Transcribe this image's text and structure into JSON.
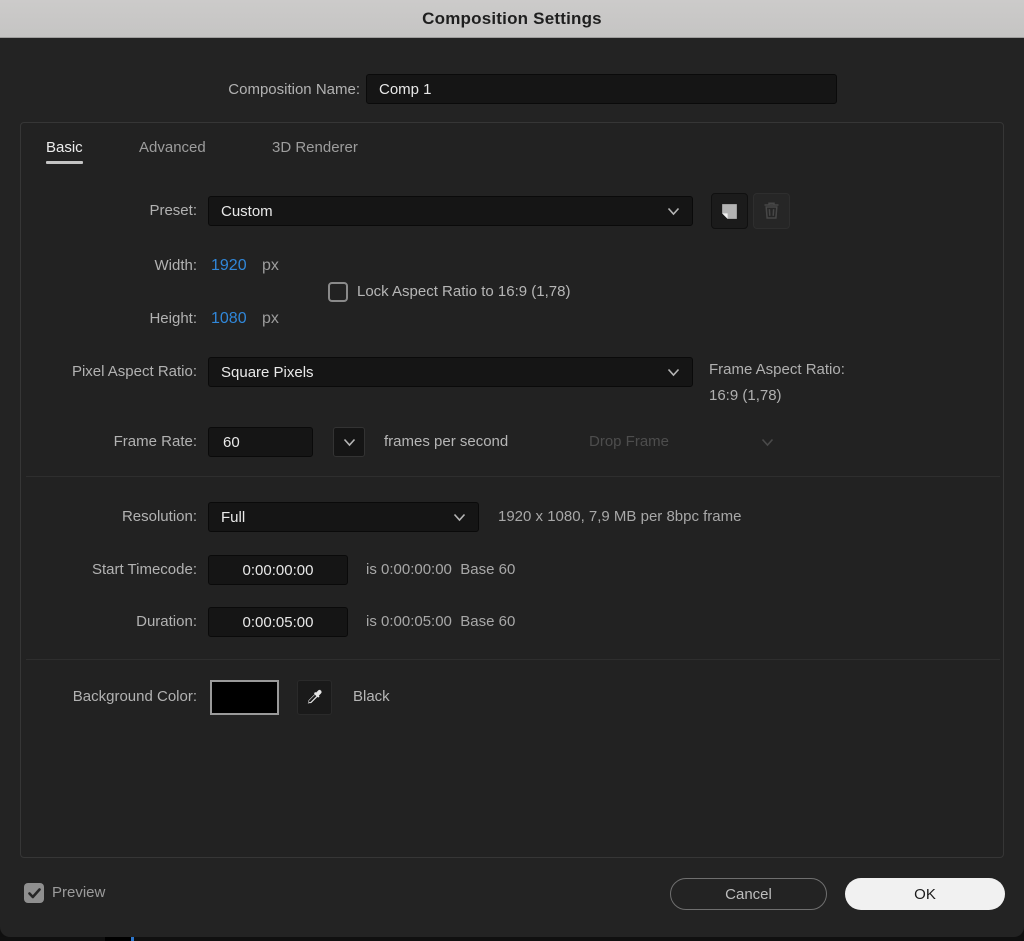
{
  "title_bar": {
    "title": "Composition Settings"
  },
  "dialog": {
    "composition_name": {
      "label": "Composition Name:",
      "value": "Comp 1"
    },
    "tabs": {
      "basic": "Basic",
      "advanced": "Advanced",
      "renderer": "3D Renderer",
      "active_tab": "Basic"
    },
    "preset": {
      "label": "Preset:",
      "value": "Custom"
    },
    "width": {
      "label": "Width:",
      "value": "1920",
      "unit": "px"
    },
    "height": {
      "label": "Height:",
      "value": "1080",
      "unit": "px"
    },
    "lock_aspect": {
      "label": "Lock Aspect Ratio to 16:9 (1,78)",
      "checked": false
    },
    "pixel_aspect_ratio": {
      "label": "Pixel Aspect Ratio:",
      "value": "Square Pixels"
    },
    "frame_aspect_ratio": {
      "label": "Frame Aspect Ratio:",
      "value": "16:9 (1,78)"
    },
    "frame_rate": {
      "label": "Frame Rate:",
      "value": "60",
      "unit_text": "frames per second",
      "drop_frame_label": "Drop Frame",
      "drop_frame_enabled": false
    },
    "resolution": {
      "label": "Resolution:",
      "value": "Full",
      "info": "1920 x 1080, 7,9 MB per 8bpc frame"
    },
    "start_timecode": {
      "label": "Start Timecode:",
      "value": "0:00:00:00",
      "info_is": "is 0:00:00:00",
      "info_base": "Base 60"
    },
    "duration": {
      "label": "Duration:",
      "value": "0:00:05:00",
      "info_is": "is 0:00:05:00",
      "info_base": "Base 60"
    },
    "background_color": {
      "label": "Background Color:",
      "swatch_color": "#000000",
      "value_name": "Black"
    }
  },
  "footer": {
    "preview": {
      "label": "Preview",
      "checked": true
    },
    "cancel_label": "Cancel",
    "ok_label": "OK"
  },
  "icons": {
    "chevron_down": "chevron-down-icon",
    "save_preset": "save-preset-icon",
    "delete_preset": "trash-icon",
    "eyedropper": "eyedropper-icon",
    "checkmark": "check-icon"
  },
  "colors": {
    "titlebar_bg": "#c8c7c5",
    "dialog_bg": "#232323",
    "input_bg": "#151515",
    "accent_blue": "#3087d9",
    "ok_button_bg": "#f1f1f1",
    "swatch_border": "#9a9a9a"
  }
}
